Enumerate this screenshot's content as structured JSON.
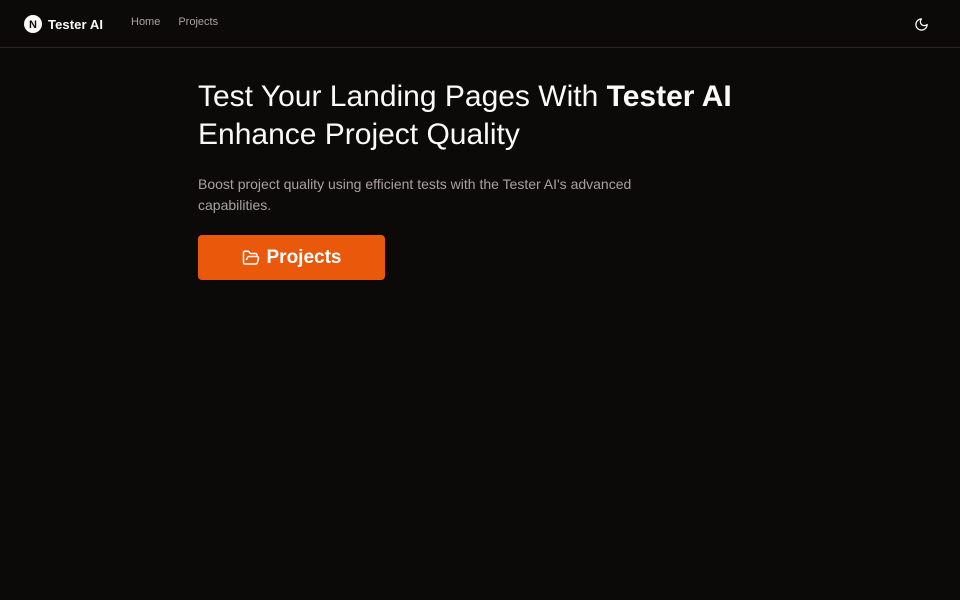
{
  "header": {
    "brand": {
      "logo_letter": "N",
      "name": "Tester AI"
    },
    "nav": [
      {
        "label": "Home"
      },
      {
        "label": "Projects"
      }
    ],
    "theme_toggle_icon": "moon-icon"
  },
  "hero": {
    "headline_part1": "Test Your Landing Pages With",
    "headline_brand": "Tester AI",
    "headline_line2": "Enhance Project Quality",
    "subtitle": "Boost project quality using efficient tests with the Tester AI's advanced capabilities.",
    "cta": {
      "label": "Projects",
      "icon": "folder-open-icon"
    }
  },
  "colors": {
    "background": "#0c0a09",
    "border": "#292524",
    "text_primary": "#fafaf9",
    "text_muted": "#a8a29e",
    "accent": "#ea580c"
  }
}
